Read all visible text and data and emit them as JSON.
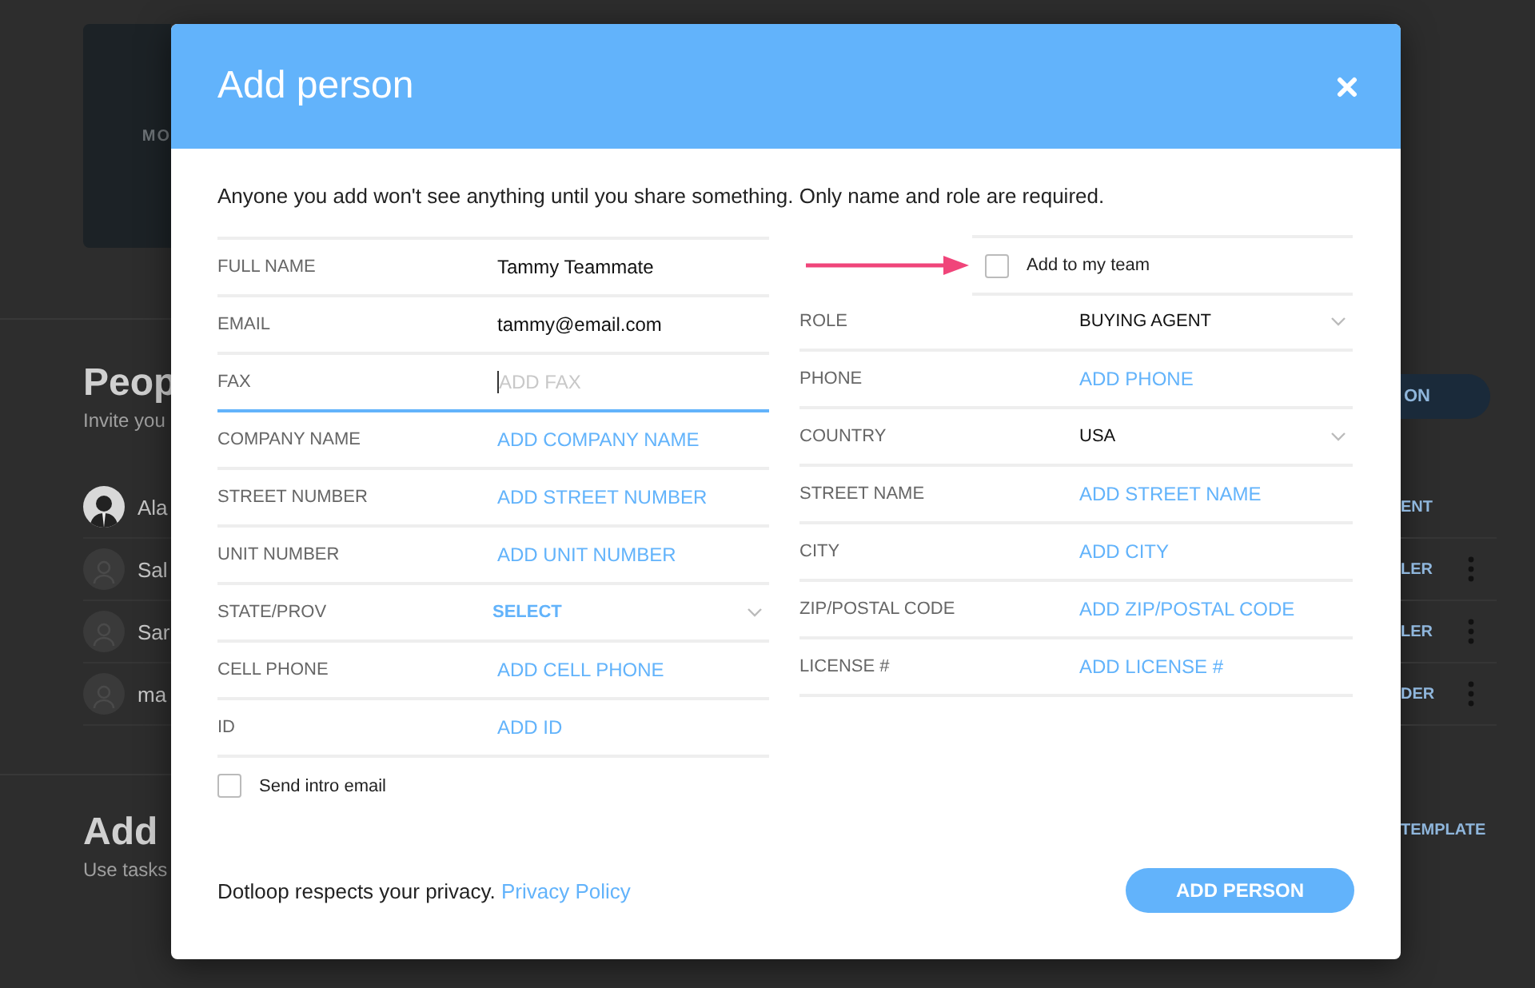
{
  "background": {
    "photo_label": "MO",
    "section_heading": "Peop",
    "section_subtitle": "Invite you",
    "invite_button": "ON",
    "people": [
      {
        "name": "Ala",
        "kind": "photo",
        "role": "ENT",
        "menu": false
      },
      {
        "name": "Sal",
        "kind": "silhouette",
        "role": "LER",
        "menu": true
      },
      {
        "name": "Sar",
        "kind": "silhouette",
        "role": "LER",
        "menu": true
      },
      {
        "name": "ma",
        "kind": "silhouette",
        "role": "DER",
        "menu": true
      }
    ],
    "tasks_heading": "Add",
    "tasks_subtitle": "Use tasks",
    "template_link": "TEMPLATE"
  },
  "dialog": {
    "title": "Add person",
    "intro": "Anyone you add won't see anything until you share something. Only name and role are required.",
    "left_fields": [
      {
        "kind": "input",
        "label": "FULL NAME",
        "value": "Tammy Teammate",
        "focused": false
      },
      {
        "kind": "input",
        "label": "EMAIL",
        "value": "tammy@email.com",
        "focused": false
      },
      {
        "kind": "input",
        "label": "FAX",
        "placeholder": "ADD FAX",
        "focused": true
      },
      {
        "kind": "input",
        "label": "COMPANY NAME",
        "placeholder": "ADD COMPANY NAME",
        "focused": false
      },
      {
        "kind": "input",
        "label": "STREET NUMBER",
        "placeholder": "ADD STREET NUMBER",
        "focused": false
      },
      {
        "kind": "input",
        "label": "UNIT NUMBER",
        "placeholder": "ADD UNIT NUMBER",
        "focused": false
      },
      {
        "kind": "select",
        "label": "STATE/PROV",
        "placeholder": "SELECT"
      },
      {
        "kind": "input",
        "label": "CELL PHONE",
        "placeholder": "ADD CELL PHONE",
        "focused": false
      },
      {
        "kind": "input",
        "label": "ID",
        "placeholder": "ADD ID",
        "focused": false
      }
    ],
    "right_fields": [
      {
        "kind": "checkbox",
        "label": "Add to my team",
        "checked": false
      },
      {
        "kind": "select",
        "label": "ROLE",
        "value": "BUYING AGENT"
      },
      {
        "kind": "input",
        "label": "PHONE",
        "placeholder": "ADD PHONE",
        "focused": false
      },
      {
        "kind": "select",
        "label": "COUNTRY",
        "value": "USA"
      },
      {
        "kind": "input",
        "label": "STREET NAME",
        "placeholder": "ADD STREET NAME",
        "focused": false
      },
      {
        "kind": "input",
        "label": "CITY",
        "placeholder": "ADD CITY",
        "focused": false
      },
      {
        "kind": "input",
        "label": "ZIP/POSTAL CODE",
        "placeholder": "ADD ZIP/POSTAL CODE",
        "focused": false
      },
      {
        "kind": "input",
        "label": "LICENSE #",
        "placeholder": "ADD LICENSE #",
        "focused": false
      }
    ],
    "send_intro": {
      "label": "Send intro email",
      "checked": false
    },
    "privacy_text": "Dotloop respects your privacy.",
    "privacy_link": "Privacy Policy",
    "submit": "ADD PERSON"
  }
}
